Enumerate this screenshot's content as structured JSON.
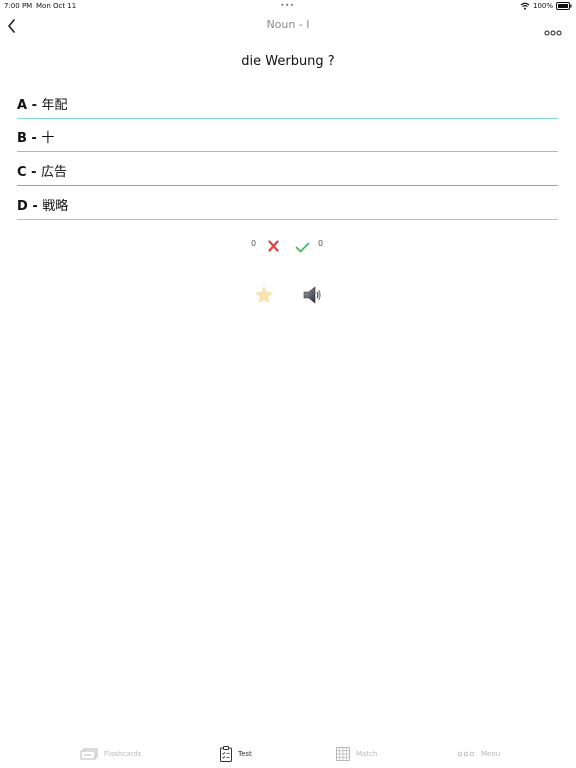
{
  "status_bar": {
    "time": "7:00 PM",
    "date": "Mon Oct 11",
    "multitask_dots": "•••",
    "battery_percent": "100%"
  },
  "nav": {
    "title": "Noun - I"
  },
  "question": {
    "text": "die Werbung ?"
  },
  "answers": [
    {
      "letter": "A - ",
      "text": "年配",
      "line_color": "#7fd6dc"
    },
    {
      "letter": "B - ",
      "text": "十",
      "line_color": "#ef9aa1"
    },
    {
      "letter": "C - ",
      "text": "広告",
      "line_color": "#4fc9a5"
    },
    {
      "letter": "D - ",
      "text": "戦略",
      "line_color": "#f2a8ae"
    }
  ],
  "score": {
    "wrong": "0",
    "right": "0",
    "wrong_color": "#e4423f",
    "right_color": "#3cb562"
  },
  "actions": {
    "star_icon": "star-icon",
    "speaker_icon": "speaker-icon",
    "star_color": "#f7e2b0"
  },
  "tabs": [
    {
      "label": "Flashcards",
      "icon": "flashcards-icon",
      "active": false
    },
    {
      "label": "Test",
      "icon": "test-clipboard-icon",
      "active": true
    },
    {
      "label": "Match",
      "icon": "grid-icon",
      "active": false
    },
    {
      "label": "Menu",
      "icon": "more-dots-icon",
      "active": false
    }
  ]
}
